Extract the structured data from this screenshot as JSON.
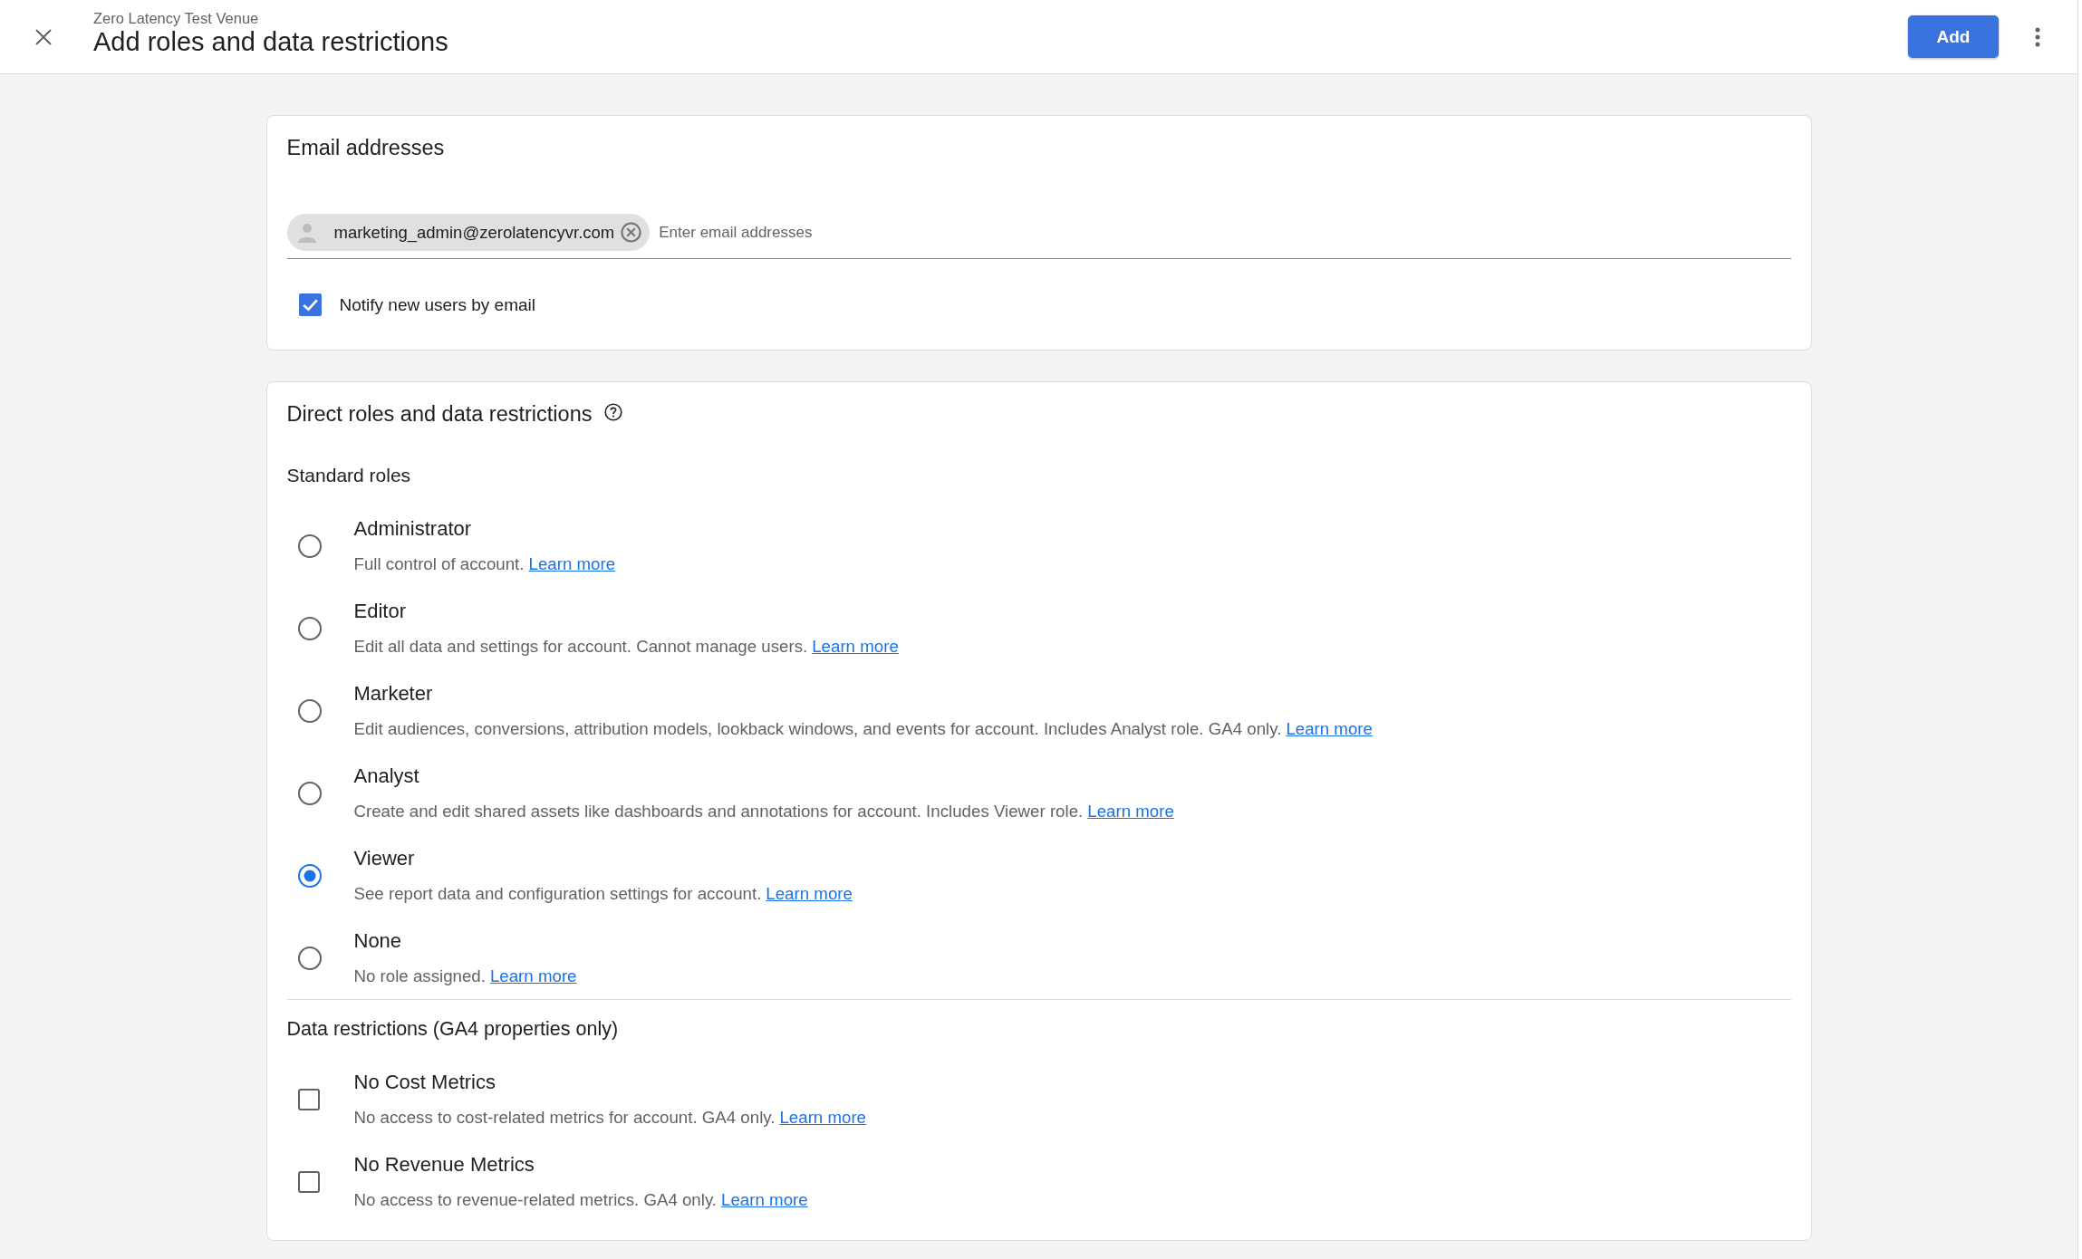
{
  "header": {
    "subtitle": "Zero Latency Test Venue",
    "title": "Add roles and data restrictions",
    "primary_button": "Add"
  },
  "email_card": {
    "title": "Email addresses",
    "chips": [
      {
        "email": "marketing_admin@zerolatencyvr.com"
      }
    ],
    "input": {
      "placeholder": "Enter email addresses"
    },
    "notify": {
      "label": "Notify new users by email",
      "checked": true
    }
  },
  "roles_card": {
    "title": "Direct roles and data restrictions",
    "standard_roles": {
      "heading": "Standard roles",
      "options": [
        {
          "name": "Administrator",
          "description": "Full control of account.",
          "link": "Learn more",
          "selected": false
        },
        {
          "name": "Editor",
          "description": "Edit all data and settings for account. Cannot manage users.",
          "link": "Learn more",
          "selected": false
        },
        {
          "name": "Marketer",
          "description": "Edit audiences, conversions, attribution models, lookback windows, and events for account. Includes Analyst role. GA4 only.",
          "link": "Learn more",
          "selected": false
        },
        {
          "name": "Analyst",
          "description": "Create and edit shared assets like dashboards and annotations for account. Includes Viewer role.",
          "link": "Learn more",
          "selected": false
        },
        {
          "name": "Viewer",
          "description": "See report data and configuration settings for account.",
          "link": "Learn more",
          "selected": true
        },
        {
          "name": "None",
          "description": "No role assigned.",
          "link": "Learn more",
          "selected": false
        }
      ]
    },
    "data_restrictions": {
      "heading": "Data restrictions (GA4 properties only)",
      "options": [
        {
          "name": "No Cost Metrics",
          "description": "No access to cost-related metrics for account. GA4 only.",
          "link": "Learn more",
          "checked": false
        },
        {
          "name": "No Revenue Metrics",
          "description": "No access to revenue-related metrics. GA4 only.",
          "link": "Learn more",
          "checked": false
        }
      ]
    }
  }
}
